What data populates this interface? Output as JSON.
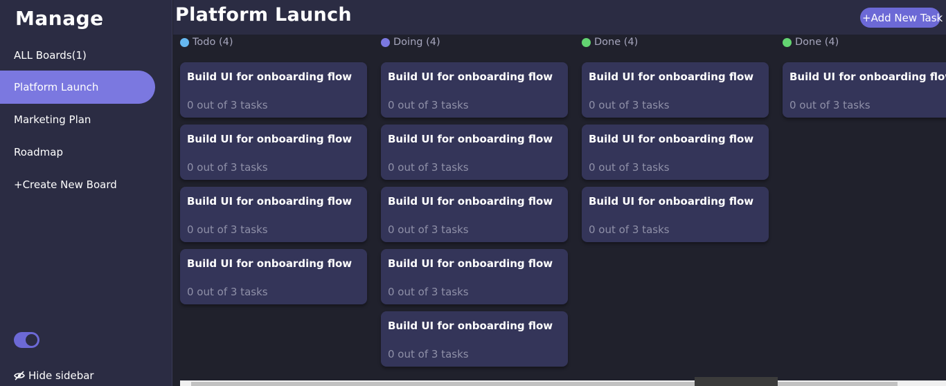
{
  "sidebar": {
    "brand": "Manage",
    "items": [
      {
        "label": "ALL Boards(1)"
      },
      {
        "label": "Platform Launch"
      },
      {
        "label": "Marketing Plan"
      },
      {
        "label": "Roadmap"
      },
      {
        "label": "+Create New Board"
      }
    ],
    "hide_label": "Hide sidebar"
  },
  "header": {
    "title": "Platform Launch",
    "add_task_label": "+Add New Task"
  },
  "colors": {
    "accent": "#6c69d6",
    "todo": "#66b8f0",
    "doing": "#7b78e0",
    "done": "#63d471"
  },
  "columns": [
    {
      "title": "Todo (4)",
      "color": "#66b8f0",
      "cards": [
        {
          "title": "Build UI for onboarding flow",
          "subtitle": "0 out of 3 tasks"
        },
        {
          "title": "Build UI for onboarding flow",
          "subtitle": "0 out of 3 tasks"
        },
        {
          "title": "Build UI for onboarding flow",
          "subtitle": "0 out of 3 tasks"
        },
        {
          "title": "Build UI for onboarding flow",
          "subtitle": "0 out of 3 tasks"
        }
      ]
    },
    {
      "title": "Doing (4)",
      "color": "#7b78e0",
      "cards": [
        {
          "title": "Build UI for onboarding flow",
          "subtitle": "0 out of 3 tasks"
        },
        {
          "title": "Build UI for onboarding flow",
          "subtitle": "0 out of 3 tasks"
        },
        {
          "title": "Build UI for onboarding flow",
          "subtitle": "0 out of 3 tasks"
        },
        {
          "title": "Build UI for onboarding flow",
          "subtitle": "0 out of 3 tasks"
        },
        {
          "title": "Build UI for onboarding flow",
          "subtitle": "0 out of 3 tasks"
        }
      ]
    },
    {
      "title": "Done (4)",
      "color": "#63d471",
      "cards": [
        {
          "title": "Build UI for onboarding flow",
          "subtitle": "0 out of 3 tasks"
        },
        {
          "title": "Build UI for onboarding flow",
          "subtitle": "0 out of 3 tasks"
        },
        {
          "title": "Build UI for onboarding flow",
          "subtitle": "0 out of 3 tasks"
        }
      ]
    },
    {
      "title": "Done (4)",
      "color": "#63d471",
      "cards": [
        {
          "title": "Build UI for onboarding flow",
          "subtitle": "0 out of 3 tasks"
        }
      ]
    }
  ]
}
